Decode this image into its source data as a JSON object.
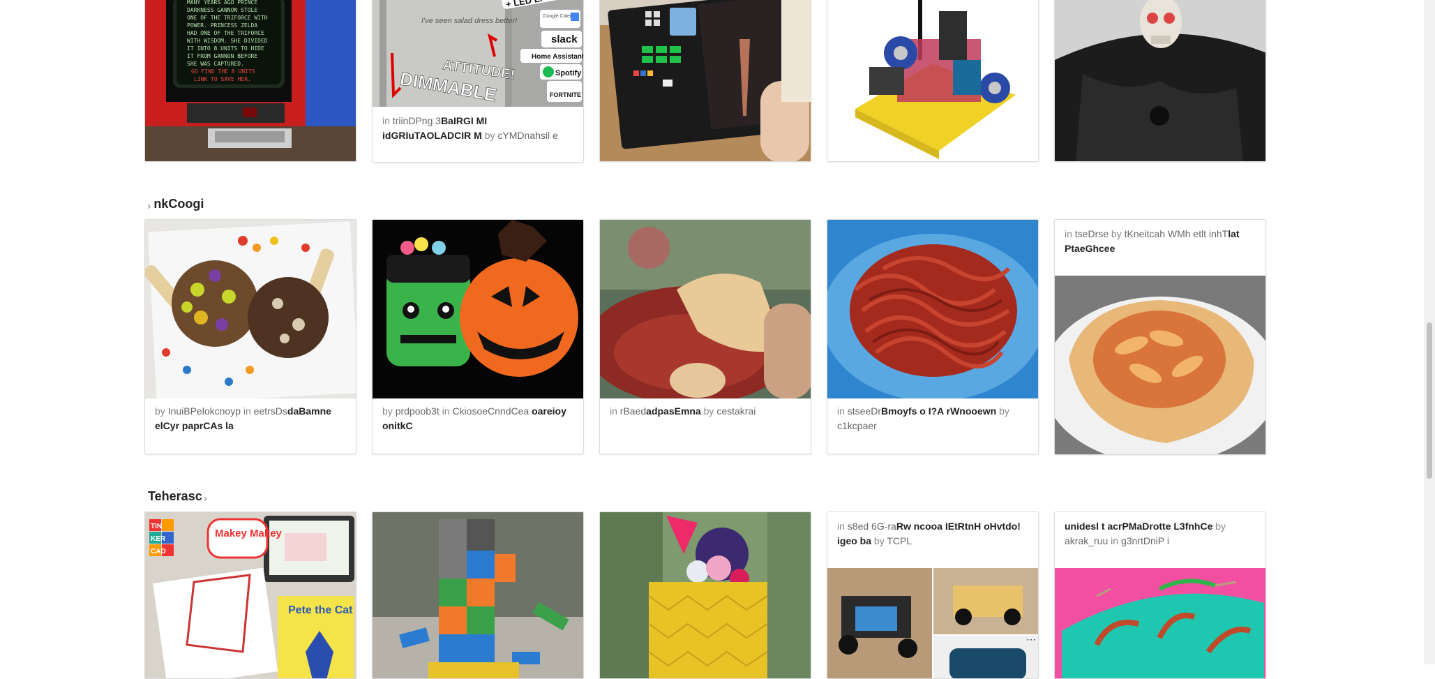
{
  "row1": {
    "card2": {
      "w_in": "in",
      "category": "triinDPng 3",
      "title": "BaIRGI MI idGRIuTAOLADCIR M",
      "w_by": "by",
      "author": "cYMDnahsil e",
      "img_text": {
        "led": "+ LED Li",
        "attitude": "ATTITUDE!",
        "dimmable": "DIMMABLE",
        "note": "I've seen salad dress better!",
        "google": "Google Calendar",
        "slack": "slack",
        "ha": "Home Assistant",
        "spotify": "Spotify",
        "fortnite": "FORTNITE"
      }
    },
    "card1": {
      "img_text": [
        "MANY YEARS AGO PRINCE",
        "DARKNESS GANNON STOLE",
        "ONE OF THE TRIFORCE WITH",
        "POWER. PRINCESS ZELDA",
        "HAD ONE OF THE TRIFORCE",
        "WITH WISDOM. SHE DIVIDED",
        "IT INTO 8 UNITS TO HIDE",
        "IT FROM GANNON BEFORE",
        "SHE WAS CAPTURED.",
        "GO FIND THE 8 UNITS",
        "LINK TO SAVE HER."
      ]
    }
  },
  "sections": [
    {
      "title": "nkCoogi",
      "chevron": "›",
      "cards": [
        {
          "w_by": "by",
          "author": "InuiBPelokcnoyp",
          "w_in": "in",
          "category": "eetrsDs",
          "title": "daBamne elCyr paprCAs la"
        },
        {
          "w_by": "by",
          "author": "prdpoob3t",
          "w_in": "in",
          "category": "CkiosoeCnndCea",
          "title": "oareioy onitkC"
        },
        {
          "w_in": "in",
          "category": "rBaed",
          "title": "adpasEmna",
          "w_by": "by",
          "author": "cestakrai"
        },
        {
          "w_in": "in",
          "category": "stseeDr",
          "title": "Bmoyfs o I?A rWnooewn",
          "w_by": "by",
          "author": "c1kcpaer"
        },
        {
          "w_in": "in",
          "category": "tseDrse",
          "w_by": "by",
          "author": "tKneitcah WMh etlt inhT",
          "title": "lat PtaeGhcee"
        }
      ]
    },
    {
      "title": "Teherasc",
      "chevron": "›",
      "cards": [
        {
          "img_text": {
            "tinkercad": [
              "TIN",
              "KER",
              "CAD"
            ],
            "makey": "Makey Makey",
            "pete": "Pete the Cat"
          }
        },
        {},
        {},
        {
          "w_in": "in",
          "category": "s8ed 6G-ra",
          "title": "Rw ncooa IEtRtnH oHvtdo! igeo ba",
          "w_by": "by",
          "author": "TCPL"
        },
        {
          "title": "unidesl t acrPMaDrotte L3fnhCe",
          "w_by": "by",
          "author": "akrak_ruu",
          "w_in": "in",
          "category": "g3nrtDniP i"
        }
      ]
    }
  ],
  "colors": {
    "accent": "#222222",
    "muted": "#888888",
    "card_border": "#dcdcdc"
  }
}
